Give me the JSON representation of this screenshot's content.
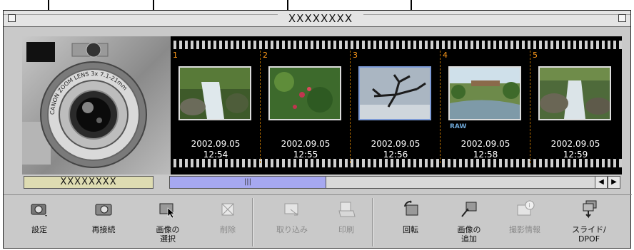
{
  "window": {
    "title": "XXXXXXXX"
  },
  "camera": {
    "lens_text": "CANON ZOOM LENS 3x  7.1-21mm"
  },
  "frames": [
    {
      "number": "1",
      "date": "2002.09.05",
      "time": "12:54",
      "raw": ""
    },
    {
      "number": "2",
      "date": "2002.09.05",
      "time": "12:55",
      "raw": ""
    },
    {
      "number": "3",
      "date": "2002.09.05",
      "time": "12:56",
      "raw": ""
    },
    {
      "number": "4",
      "date": "2002.09.05",
      "time": "12:58",
      "raw": "RAW"
    },
    {
      "number": "5",
      "date": "2002.09.05",
      "time": "12:59",
      "raw": ""
    }
  ],
  "label_box": "XXXXXXXX",
  "scroll": {
    "thumb_grip": "|||",
    "left_arrow": "◀",
    "right_arrow": "▶"
  },
  "toolbar": {
    "settings": "設定",
    "reconnect": "再接続",
    "select_line1": "画像の",
    "select_line2": "選択",
    "delete": "削除",
    "import": "取り込み",
    "print": "印刷",
    "rotate": "回転",
    "add_line1": "画像の",
    "add_line2": "追加",
    "shooting_info": "撮影情報",
    "slide_line1": "スライド/",
    "slide_line2": "DPOF"
  },
  "colors": {
    "frame_number": "#ff9a1a",
    "label_box_bg": "#dedcb2",
    "scroll_thumb": "#a6a8f0"
  }
}
